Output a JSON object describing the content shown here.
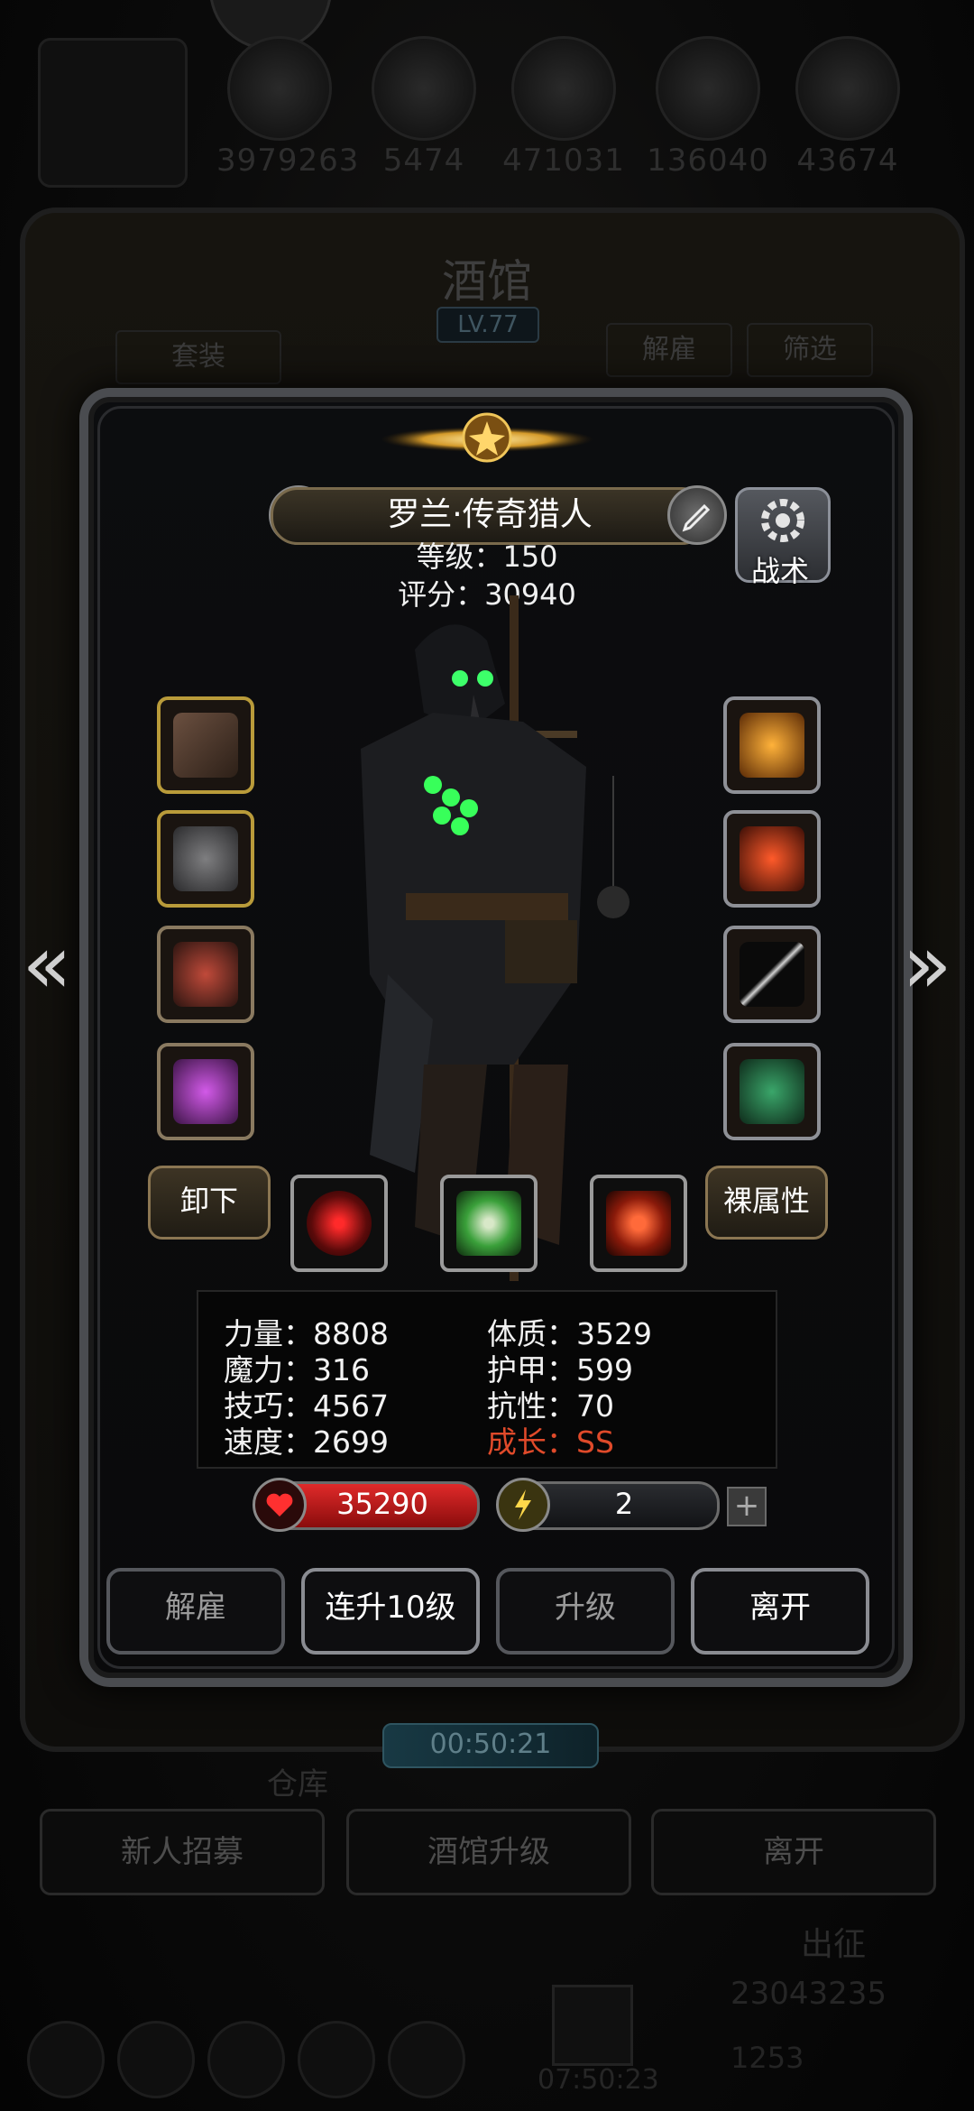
{
  "resources": [
    {
      "icon": "gold-coin-icon",
      "value": "3979263"
    },
    {
      "icon": "bread-icon",
      "value": "5474"
    },
    {
      "icon": "iron-icon",
      "value": "471031"
    },
    {
      "icon": "crystal-icon",
      "value": "136040"
    },
    {
      "icon": "stone-icon",
      "value": "43674"
    }
  ],
  "tavern": {
    "title": "酒馆",
    "level": "LV.77",
    "set_tab": "套装",
    "dismiss_tab": "解雇",
    "filter_tab": "筛选",
    "timer": "00:50:21",
    "warehouse": "仓库",
    "recruit": "新人招募",
    "upgrade_tavern": "酒馆升级",
    "leave": "离开",
    "expedition": "出征",
    "bottom_count": "23043235",
    "bottom_count2": "1253",
    "bottom_timer": "07:50:23"
  },
  "hero": {
    "name": "罗兰·传奇猎人",
    "level_line": "等级：150",
    "score_line": "评分：30940",
    "tactics_label": "战术",
    "unequip": "卸下",
    "base_attr": "裸属性"
  },
  "stats": {
    "str": "力量：8808",
    "con": "体质：3529",
    "mag": "魔力：316",
    "arm": "护甲：599",
    "skl": "技巧：4567",
    "res": "抗性：70",
    "spd": "速度：2699",
    "growth": "成长：SS"
  },
  "bars": {
    "hp": "35290",
    "energy": "2",
    "plus": "+"
  },
  "actions": {
    "dismiss": "解雇",
    "level10": "连升10级",
    "levelup": "升级",
    "leave": "离开"
  },
  "colors": {
    "accent_gold": "#b99b3a",
    "hp_red": "#d01e1e",
    "growth_red": "#e04a2a"
  }
}
